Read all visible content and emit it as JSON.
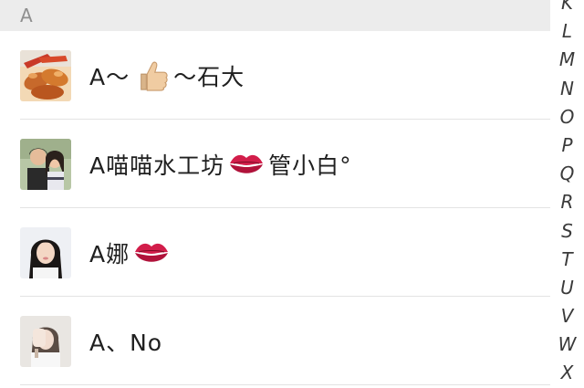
{
  "section": {
    "letter": "A"
  },
  "contacts": [
    {
      "name_prefix": "A～",
      "emoji": "thumbs-up-icon",
      "name_suffix": "～石大",
      "avatar": "food-photo-avatar"
    },
    {
      "name_prefix": "A喵喵水工坊",
      "emoji": "lips-kiss-icon",
      "name_suffix": "管小白°",
      "avatar": "couple-photo-avatar"
    },
    {
      "name_prefix": "A娜",
      "emoji": "lips-kiss-icon",
      "name_suffix": "",
      "avatar": "girl-photo-avatar"
    },
    {
      "name_prefix": "A、No",
      "emoji": "",
      "name_suffix": "",
      "avatar": "selfie-photo-avatar"
    }
  ],
  "index_bar": [
    "K",
    "L",
    "M",
    "N",
    "O",
    "P",
    "Q",
    "R",
    "S",
    "T",
    "U",
    "V",
    "W",
    "X"
  ],
  "colors": {
    "header_bg": "#ececec",
    "divider": "#e3e3e3",
    "text": "#202020",
    "lips": "#d21d4a"
  }
}
